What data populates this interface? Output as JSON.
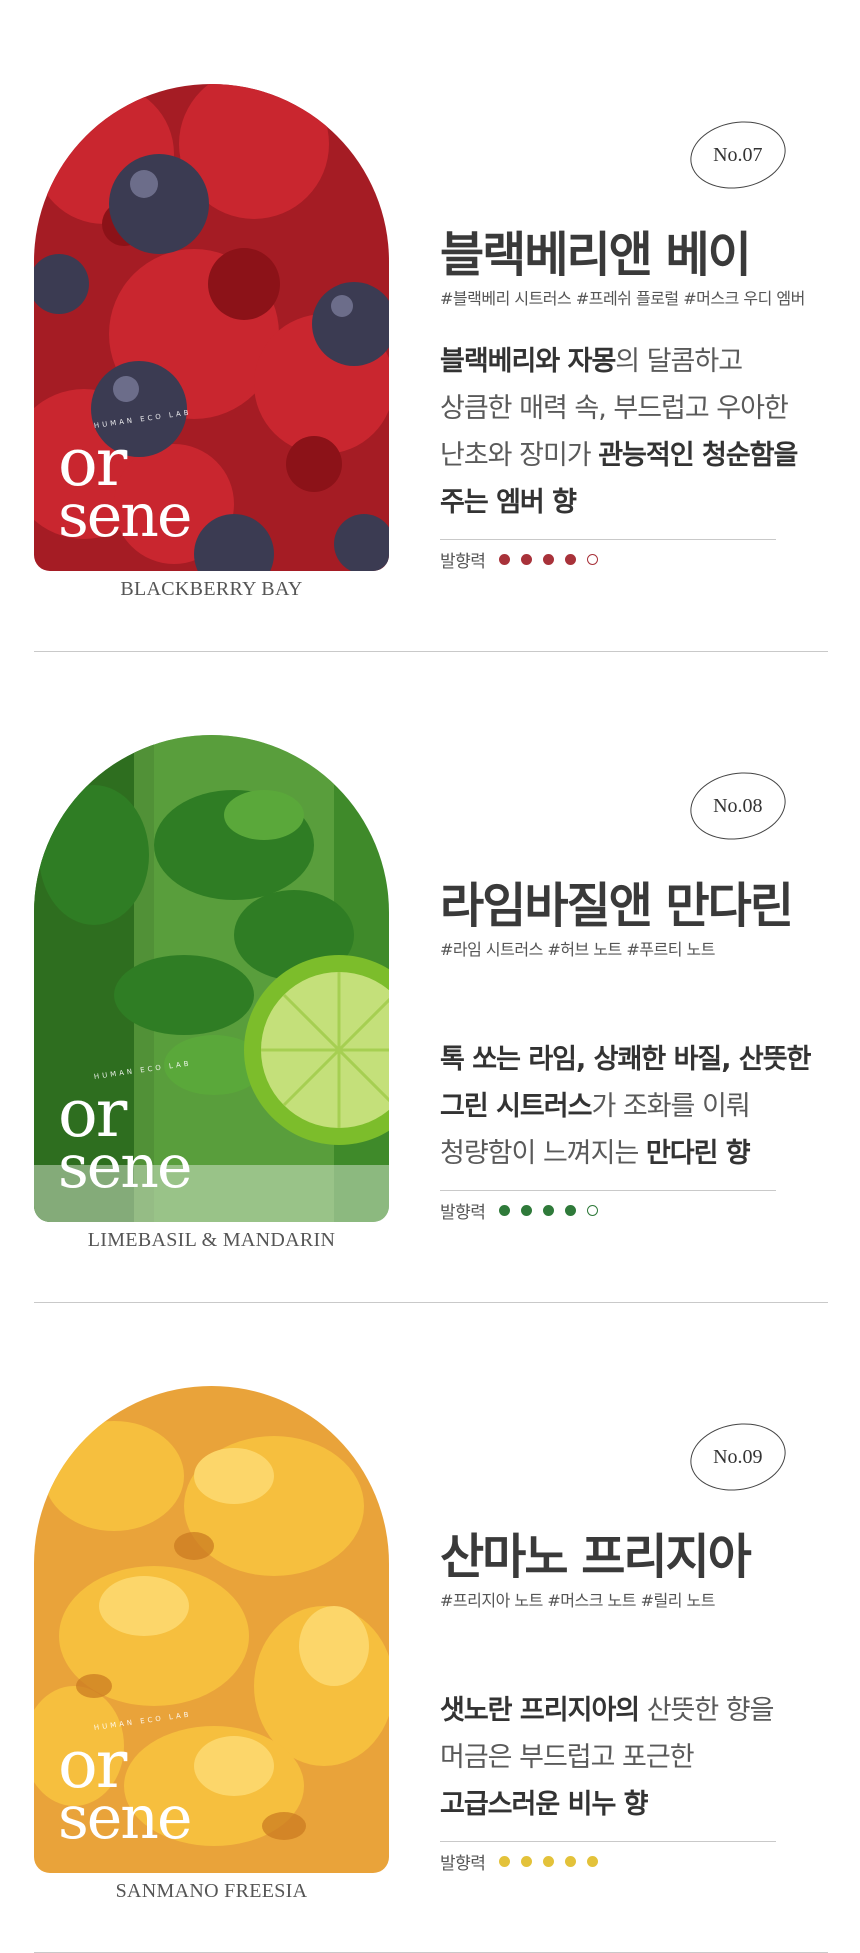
{
  "products": [
    {
      "number": "No.07",
      "name": "블랙베리앤 베이",
      "tags": "#블랙베리 시트러스 #프레쉬 플로럴 #머스크 우디 엠버",
      "desc": [
        [
          {
            "t": "블랙베리와 자몽",
            "b": true
          },
          {
            "t": "의 달콤하고",
            "b": false
          }
        ],
        [
          {
            "t": "상큼한 매력 속, 부드럽고 우아한",
            "b": false
          }
        ],
        [
          {
            "t": "난초와 장미가 ",
            "b": false
          },
          {
            "t": "관능적인 청순함을",
            "b": true
          }
        ],
        [
          {
            "t": "주는 엠버 향",
            "b": true
          }
        ]
      ],
      "caption": "BLACKBERRY BAY",
      "intensity_label": "발향력",
      "intensity": 4,
      "intensity_max": 5,
      "accent": "#a8323a",
      "image": "raspberries-blueberries",
      "logo_top": "or",
      "logo_bottom": "sene",
      "logo_sub": "HUMAN ECO LAB"
    },
    {
      "number": "No.08",
      "name": "라임바질앤 만다린",
      "tags": "#라임 시트러스 #허브 노트 #푸르티 노트",
      "desc": [
        [
          {
            "t": "톡 쏘는 라임, 상쾌한 바질, 산뜻한",
            "b": true
          }
        ],
        [
          {
            "t": "그린 시트러스",
            "b": true
          },
          {
            "t": "가 조화를 이뤄",
            "b": false
          }
        ],
        [
          {
            "t": "청량함이 느껴지는 ",
            "b": false
          },
          {
            "t": "만다린 향",
            "b": true
          }
        ]
      ],
      "caption": "LIMEBASIL & MANDARIN",
      "intensity_label": "발향력",
      "intensity": 4,
      "intensity_max": 5,
      "accent": "#2f7a3a",
      "image": "lime-mint-glass",
      "logo_top": "or",
      "logo_bottom": "sene",
      "logo_sub": "HUMAN ECO LAB"
    },
    {
      "number": "No.09",
      "name": "산마노 프리지아",
      "tags": "#프리지아 노트 #머스크 노트 #릴리 노트",
      "desc": [
        [
          {
            "t": "샛노란 프리지아의",
            "b": true
          },
          {
            "t": " 산뜻한 향을",
            "b": false
          }
        ],
        [
          {
            "t": "머금은 부드럽고 포근한",
            "b": false
          }
        ],
        [
          {
            "t": "고급스러운 비누 향",
            "b": true
          }
        ]
      ],
      "caption": "SANMANO FREESIA",
      "intensity_label": "발향력",
      "intensity": 5,
      "intensity_max": 5,
      "accent": "#e3c23a",
      "image": "yellow-freesia",
      "logo_top": "or",
      "logo_bottom": "sene",
      "logo_sub": "HUMAN ECO LAB"
    }
  ]
}
